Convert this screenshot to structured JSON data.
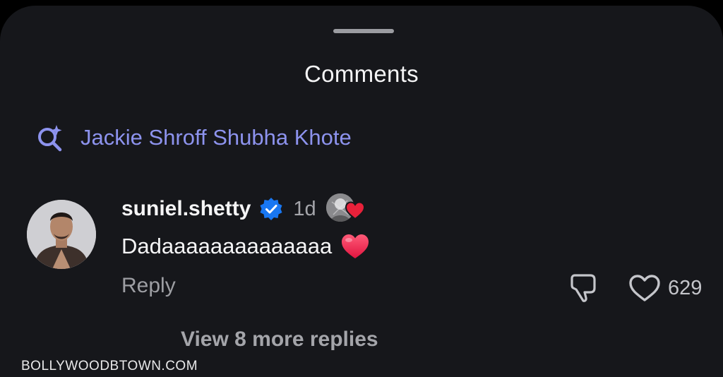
{
  "sheet": {
    "title": "Comments"
  },
  "search_suggestion": {
    "icon": "ai-search-icon",
    "text": "Jackie Shroff Shubha Khote",
    "color": "#8d93ee"
  },
  "comment": {
    "username": "suniel.shetty",
    "verified": true,
    "verified_color": "#1877f2",
    "time": "1d",
    "liked_by_author_heart_color": "#e8213a",
    "text": "Dadaaaaaaaaaaaaaa",
    "reply_label": "Reply",
    "like_count": "629"
  },
  "replies": {
    "view_more_label": "View 8 more replies"
  },
  "watermark": {
    "text": "BOLLYWOODBTOWN.COM"
  },
  "colors": {
    "background": "#16171b",
    "text_primary": "#f5f5f6",
    "text_secondary": "#a4a5aa"
  }
}
